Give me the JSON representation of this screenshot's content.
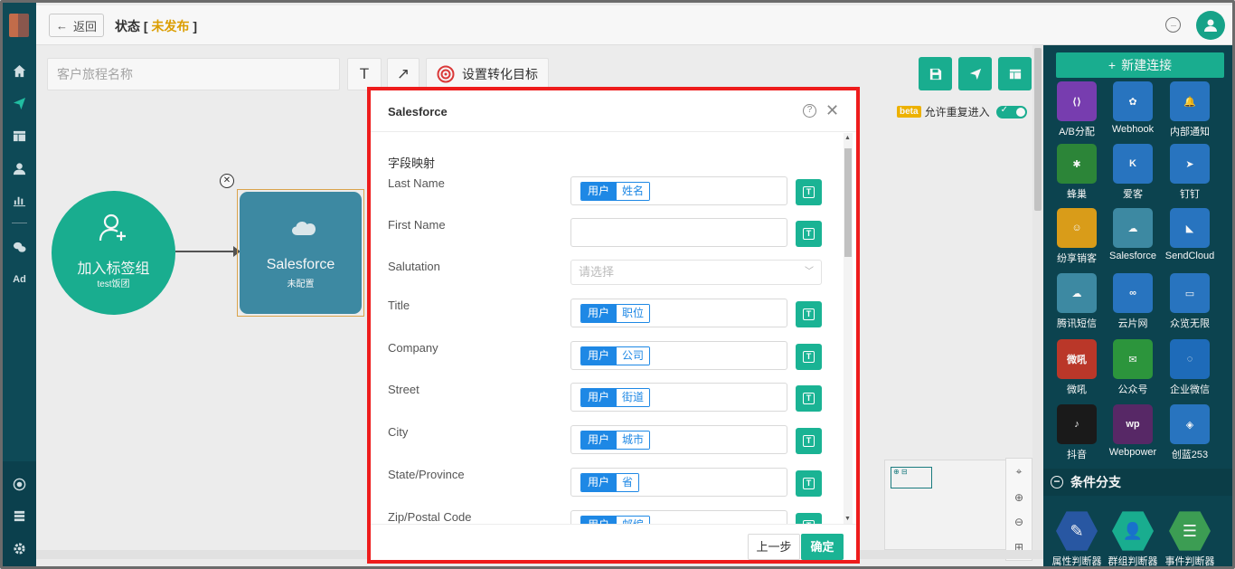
{
  "topbar": {
    "back_label": "返回",
    "status_prefix": "状态 [",
    "status_value": "未发布",
    "status_suffix": "]"
  },
  "toolbar": {
    "journey_name_placeholder": "客户旅程名称",
    "text_tool": "T",
    "arrow_tool": "↗",
    "goal_label": "设置转化目标"
  },
  "beta": {
    "badge": "beta",
    "label": "允许重复进入"
  },
  "nodes": {
    "trigger": {
      "title": "加入标签组",
      "subtitle": "test饭团"
    },
    "salesforce": {
      "title": "Salesforce",
      "subtitle": "未配置"
    }
  },
  "right_panel": {
    "new_connection": "新建连接",
    "tiles": [
      {
        "label": "A/B分配",
        "icon": "ab-split-icon",
        "color": "#7b3fb5"
      },
      {
        "label": "Webhook",
        "icon": "webhook-icon",
        "color": "#2a78c6"
      },
      {
        "label": "内部通知",
        "icon": "bell-icon",
        "color": "#2a78c6"
      },
      {
        "label": "蜂巢",
        "icon": "bee-icon",
        "color": "#2e8a3a"
      },
      {
        "label": "爱客",
        "icon": "aike-icon",
        "color": "#2a78c6"
      },
      {
        "label": "钉钉",
        "icon": "dingtalk-icon",
        "color": "#2a78c6"
      },
      {
        "label": "纷享销客",
        "icon": "fxiaoke-icon",
        "color": "#e0a21a"
      },
      {
        "label": "Salesforce",
        "icon": "salesforce-cloud-icon",
        "color": "#3f8ea8"
      },
      {
        "label": "SendCloud",
        "icon": "sendcloud-icon",
        "color": "#2a78c6"
      },
      {
        "label": "腾讯短信",
        "icon": "tencent-cloud-icon",
        "color": "#3f8ea8"
      },
      {
        "label": "云片网",
        "icon": "yunpian-icon",
        "color": "#2a78c6"
      },
      {
        "label": "众览无限",
        "icon": "zhonglan-icon",
        "color": "#2a78c6"
      },
      {
        "label": "微吼",
        "icon": "vhall-icon",
        "color": "#c0392b"
      },
      {
        "label": "公众号",
        "icon": "wechat-icon",
        "color": "#2e9a3e"
      },
      {
        "label": "企业微信",
        "icon": "wecom-icon",
        "color": "#1f6fbf"
      },
      {
        "label": "抖音",
        "icon": "douyin-icon",
        "color": "#1b1b1b"
      },
      {
        "label": "Webpower",
        "icon": "webpower-icon",
        "color": "#5a2a6a"
      },
      {
        "label": "创蓝253",
        "icon": "chuanglan-icon",
        "color": "#2a78c6"
      }
    ],
    "condition_header": "条件分支",
    "condition_tiles": [
      {
        "label": "属性判断器",
        "icon": "edit-icon",
        "color": "#2a5aa8"
      },
      {
        "label": "群组判断器",
        "icon": "group-icon",
        "color": "#1ab394"
      },
      {
        "label": "事件判断器",
        "icon": "list-icon",
        "color": "#3ea356"
      }
    ]
  },
  "minimap": {
    "box_label": "⊕ ⊟"
  },
  "modal": {
    "title": "Salesforce",
    "section": "字段映射",
    "fields": [
      {
        "label": "Last Name",
        "kind": "tag",
        "tag_a": "用户",
        "tag_b": "姓名"
      },
      {
        "label": "First Name",
        "kind": "empty"
      },
      {
        "label": "Salutation",
        "kind": "select",
        "placeholder": "请选择"
      },
      {
        "label": "Title",
        "kind": "tag",
        "tag_a": "用户",
        "tag_b": "职位"
      },
      {
        "label": "Company",
        "kind": "tag",
        "tag_a": "用户",
        "tag_b": "公司"
      },
      {
        "label": "Street",
        "kind": "tag",
        "tag_a": "用户",
        "tag_b": "街道"
      },
      {
        "label": "City",
        "kind": "tag",
        "tag_a": "用户",
        "tag_b": "城市"
      },
      {
        "label": "State/Province",
        "kind": "tag",
        "tag_a": "用户",
        "tag_b": "省"
      },
      {
        "label": "Zip/Postal Code",
        "kind": "tag",
        "tag_a": "用户",
        "tag_b": "邮编"
      }
    ],
    "prev_label": "上一步",
    "ok_label": "确定"
  }
}
